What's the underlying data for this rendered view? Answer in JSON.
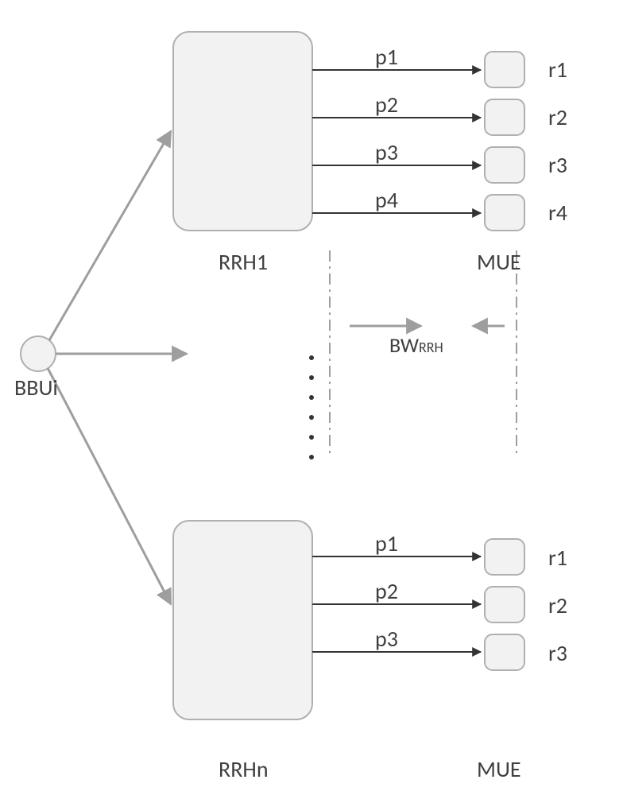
{
  "bbu": {
    "label": "BBUi"
  },
  "rrh_top": {
    "label": "RRH1",
    "paths": [
      "p1",
      "p2",
      "p3",
      "p4"
    ],
    "mue": [
      "r1",
      "r2",
      "r3",
      "r4"
    ]
  },
  "rrh_bottom": {
    "label": "RRHn",
    "paths": [
      "p1",
      "p2",
      "p3"
    ],
    "mue": [
      "r1",
      "r2",
      "r3"
    ]
  },
  "mue_label_top": "MUE",
  "mue_label_bottom": "MUE",
  "bandwidth": {
    "base": "BW",
    "sub": "RRH"
  }
}
